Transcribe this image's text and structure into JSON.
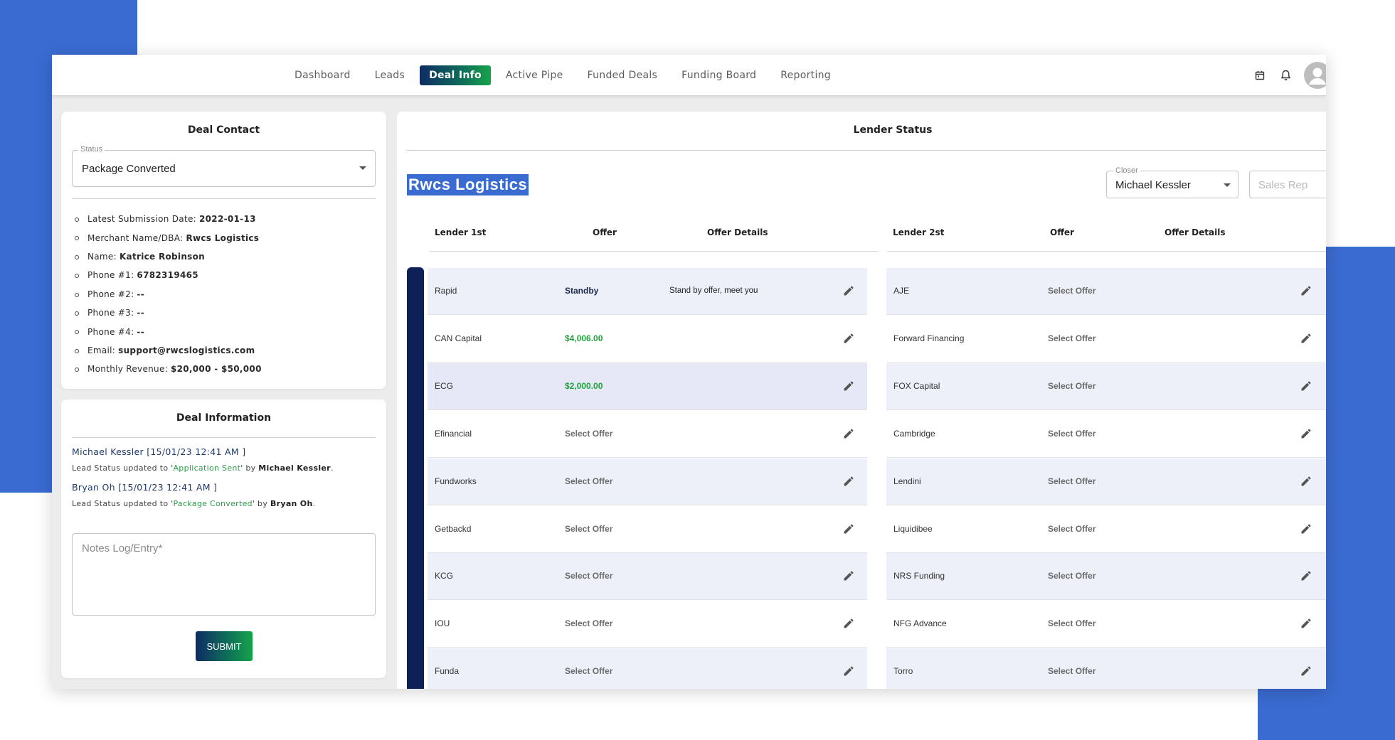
{
  "nav": {
    "items": [
      "Dashboard",
      "Leads",
      "Deal Info",
      "Active Pipe",
      "Funded Deals",
      "Funding Board",
      "Reporting"
    ],
    "active": "Deal Info",
    "icons": [
      "calendar-icon",
      "bell-icon",
      "user-avatar-icon"
    ]
  },
  "contact": {
    "title": "Deal Contact",
    "status_label": "Status",
    "status_value": "Package Converted",
    "fields": [
      {
        "label": "Latest Submission Date:",
        "value": "2022-01-13"
      },
      {
        "label": "Merchant Name/DBA:",
        "value": "Rwcs Logistics"
      },
      {
        "label": "Name:",
        "value": "Katrice Robinson"
      },
      {
        "label": "Phone #1:",
        "value": "6782319465"
      },
      {
        "label": "Phone #2:",
        "value": "--"
      },
      {
        "label": "Phone #3:",
        "value": "--"
      },
      {
        "label": "Phone #4:",
        "value": "--"
      },
      {
        "label": "Email:",
        "value": "support@rwcslogistics.com"
      },
      {
        "label": "Monthly Revenue:",
        "value": "$20,000 - $50,000"
      }
    ]
  },
  "info": {
    "title": "Deal Information",
    "logs": [
      {
        "head": "Michael Kessler [15/01/23 12:41 AM ]",
        "prefix": "Lead Status updated to '",
        "status": "Application Sent",
        "mid": "' by ",
        "by": "Michael Kessler",
        "suffix": "."
      },
      {
        "head": "Bryan Oh [15/01/23 12:41 AM ]",
        "prefix": "Lead Status updated to '",
        "status": "Package Converted",
        "mid": "' by ",
        "by": "Bryan Oh",
        "suffix": "."
      }
    ],
    "notes_placeholder": "Notes Log/Entry*",
    "submit_label": "SUBMIT"
  },
  "lender": {
    "title": "Lender Status",
    "merchant": "Rwcs Logistics",
    "closer_label": "Closer",
    "closer_value": "Michael Kessler",
    "salesrep_placeholder": "Sales Rep",
    "headers_left": [
      "Lender 1st",
      "Offer",
      "Offer Details"
    ],
    "headers_right": [
      "Lender 2st",
      "Offer",
      "Offer Details"
    ],
    "left_rows": [
      {
        "name": "Rapid",
        "offer": "Standby",
        "kind": "standby",
        "details": "Stand by offer, meet you"
      },
      {
        "name": "CAN Capital",
        "offer": "$4,006.00",
        "kind": "money",
        "details": ""
      },
      {
        "name": "ECG",
        "offer": "$2,000.00",
        "kind": "money",
        "details": ""
      },
      {
        "name": "Efinancial",
        "offer": "Select Offer",
        "kind": "select",
        "details": ""
      },
      {
        "name": "Fundworks",
        "offer": "Select Offer",
        "kind": "select",
        "details": ""
      },
      {
        "name": "Getbackd",
        "offer": "Select Offer",
        "kind": "select",
        "details": ""
      },
      {
        "name": "KCG",
        "offer": "Select Offer",
        "kind": "select",
        "details": ""
      },
      {
        "name": "IOU",
        "offer": "Select Offer",
        "kind": "select",
        "details": ""
      },
      {
        "name": "Funda",
        "offer": "Select Offer",
        "kind": "select",
        "details": ""
      }
    ],
    "right_rows": [
      {
        "name": "AJE",
        "offer": "Select Offer"
      },
      {
        "name": "Forward Financing",
        "offer": "Select Offer"
      },
      {
        "name": "FOX Capital",
        "offer": "Select Offer"
      },
      {
        "name": "Cambridge",
        "offer": "Select Offer"
      },
      {
        "name": "Lendini",
        "offer": "Select Offer"
      },
      {
        "name": "Liquidibee",
        "offer": "Select Offer"
      },
      {
        "name": "NRS Funding",
        "offer": "Select Offer"
      },
      {
        "name": "NFG Advance",
        "offer": "Select Offer"
      },
      {
        "name": "Torro",
        "offer": "Select Offer"
      }
    ]
  },
  "colors": {
    "brand_blue": "#3a6bd1",
    "navy": "#0d2058",
    "green": "#1ba83a"
  }
}
